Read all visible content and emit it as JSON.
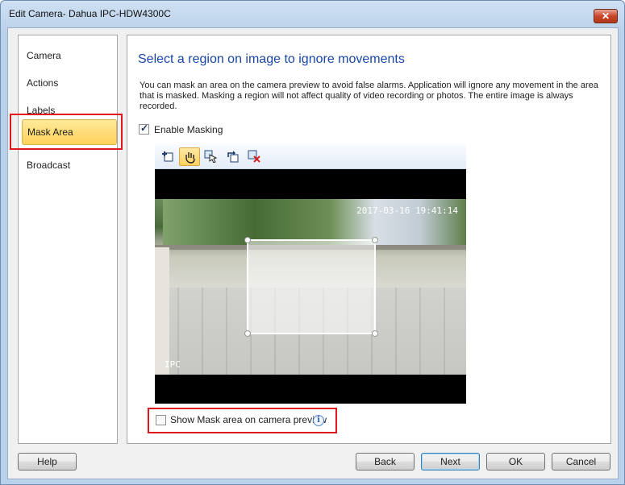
{
  "window": {
    "title": "Edit Camera- Dahua IPC-HDW4300C",
    "close_glyph": "✕"
  },
  "sidebar": {
    "items": [
      {
        "label": "Camera",
        "selected": false
      },
      {
        "label": "Actions",
        "selected": false
      },
      {
        "label": "Labels",
        "selected": false
      },
      {
        "label": "Mask Area",
        "selected": true
      },
      {
        "label": "Broadcast",
        "selected": false
      }
    ]
  },
  "main": {
    "heading": "Select a region on image to ignore movements",
    "description": "You can mask an area on the camera preview to avoid false alarms. Application will ignore any movement in the area that is masked. Masking a region will not affect quality of video recording or photos. The entire image is always recorded.",
    "enable_masking": {
      "label": "Enable Masking",
      "checked": true
    },
    "toolbar": {
      "tools": [
        {
          "icon": "add-mask-icon",
          "active": false
        },
        {
          "icon": "hand-pan-icon",
          "active": true
        },
        {
          "icon": "select-pointer-icon",
          "active": false
        },
        {
          "icon": "rotate-icon",
          "active": false
        },
        {
          "icon": "delete-mask-icon",
          "active": false
        }
      ]
    },
    "preview": {
      "timestamp": "2017-03-16 19:41:14",
      "channel": "IPC"
    },
    "show_mask": {
      "label": "Show Mask area on camera preview",
      "checked": false
    },
    "info_glyph": "i"
  },
  "buttons": {
    "help": "Help",
    "back": "Back",
    "next": "Next",
    "ok": "OK",
    "cancel": "Cancel"
  },
  "colors": {
    "heading": "#1a46a8",
    "highlight": "#e0171c",
    "selected_nav": "#fdd25a"
  }
}
